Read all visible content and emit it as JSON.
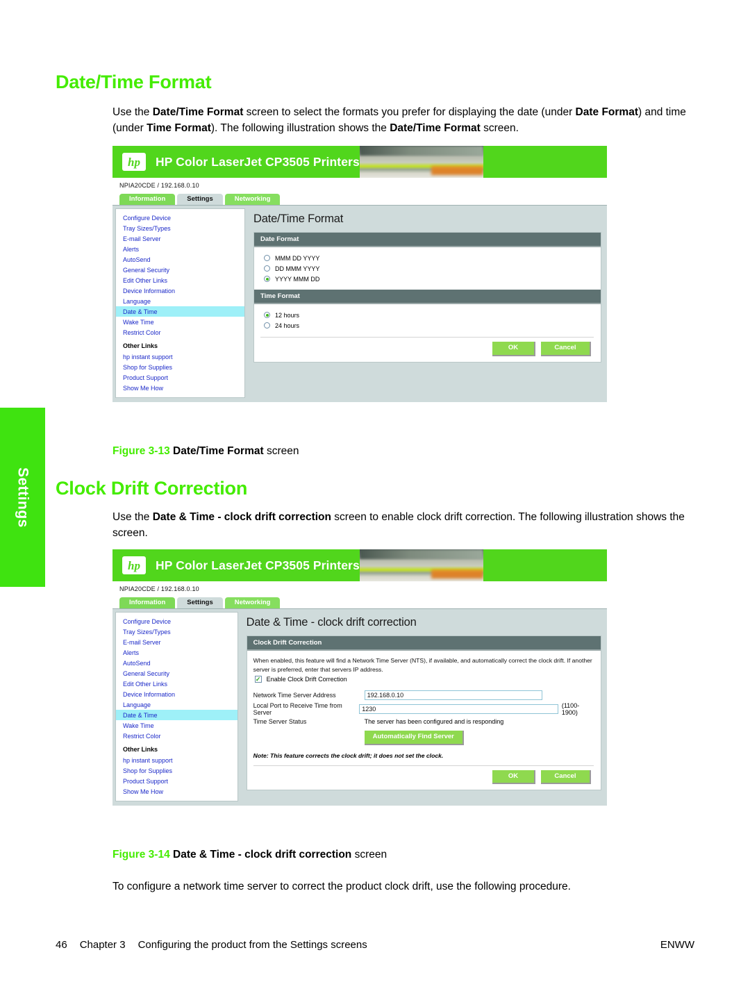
{
  "side_tab": {
    "label": "Settings"
  },
  "sections": {
    "datetime": {
      "heading": "Date/Time Format",
      "body_html": "Use the <b>Date/Time Format</b> screen to select the formats you prefer for displaying the date (under <b>Date Format</b>) and time (under <b>Time Format</b>). The following illustration shows the <b>Date/Time Format</b> screen."
    },
    "clock": {
      "heading": "Clock Drift Correction",
      "body_html": "Use the <b>Date &amp; Time - clock drift correction</b> screen to enable clock drift correction. The following illustration shows the screen."
    },
    "closing": {
      "body_html": "To configure a network time server to correct the product clock drift, use the following procedure."
    }
  },
  "captions": {
    "fig313": {
      "number": "Figure 3-13",
      "bold": "Date/Time Format",
      "rest": " screen"
    },
    "fig314": {
      "number": "Figure 3-14",
      "bold": "Date & Time - clock drift correction",
      "rest": " screen"
    }
  },
  "footer": {
    "page_number": "46",
    "chapter": "Chapter 3",
    "chapter_title": "Configuring the product from the Settings screens",
    "locale": "ENWW"
  },
  "ews_common": {
    "banner_title": "HP Color LaserJet CP3505 Printers",
    "logo_text": "hp",
    "device_id": "NPIA20CDE / 192.168.0.10",
    "tabs": [
      {
        "label": "Information",
        "active": false
      },
      {
        "label": "Settings",
        "active": true
      },
      {
        "label": "Networking",
        "active": false
      }
    ],
    "nav_items": [
      "Configure Device",
      "Tray Sizes/Types",
      "E-mail Server",
      "Alerts",
      "AutoSend",
      "General Security",
      "Edit Other Links",
      "Device Information",
      "Language",
      "Date & Time",
      "Wake Time",
      "Restrict Color"
    ],
    "nav_selected": "Date & Time",
    "other_links_head": "Other Links",
    "other_links": [
      "hp instant support",
      "Shop for Supplies",
      "Product Support",
      "Show Me How"
    ],
    "ok_label": "OK",
    "cancel_label": "Cancel"
  },
  "ews_datetime": {
    "page_title": "Date/Time Format",
    "date_format": {
      "header": "Date Format",
      "options": [
        {
          "label": "MMM DD YYYY",
          "selected": false
        },
        {
          "label": "DD MMM YYYY",
          "selected": false
        },
        {
          "label": "YYYY MMM DD",
          "selected": true
        }
      ]
    },
    "time_format": {
      "header": "Time Format",
      "options": [
        {
          "label": "12 hours",
          "selected": true
        },
        {
          "label": "24 hours",
          "selected": false
        }
      ]
    }
  },
  "ews_clock": {
    "page_title": "Date & Time - clock drift correction",
    "panel_header": "Clock Drift Correction",
    "description": "When enabled, this feature will find a Network Time Server (NTS), if available, and automatically correct the clock drift. If another server is preferred, enter that servers IP address.",
    "enable_checkbox": {
      "label": "Enable Clock Drift Correction",
      "checked": true,
      "mark": "✓"
    },
    "fields": {
      "server_address_label": "Network Time Server Address",
      "server_address_value": "192.168.0.10",
      "local_port_label": "Local Port to Receive Time from Server",
      "local_port_value": "1230",
      "local_port_hint": "(1100-1900)",
      "status_label": "Time Server Status",
      "status_value": "The server has been configured and is responding"
    },
    "find_server_button": "Automatically Find Server",
    "note": "Note: This feature corrects the clock drift; it does not set the clock."
  },
  "colors": {
    "accent_green": "#44ec00",
    "hp_green": "#51d61c",
    "button_green": "#8fd94f",
    "panel_header": "#5e7272",
    "link_blue": "#1a28c8",
    "selected_nav": "#9ef0f8"
  }
}
